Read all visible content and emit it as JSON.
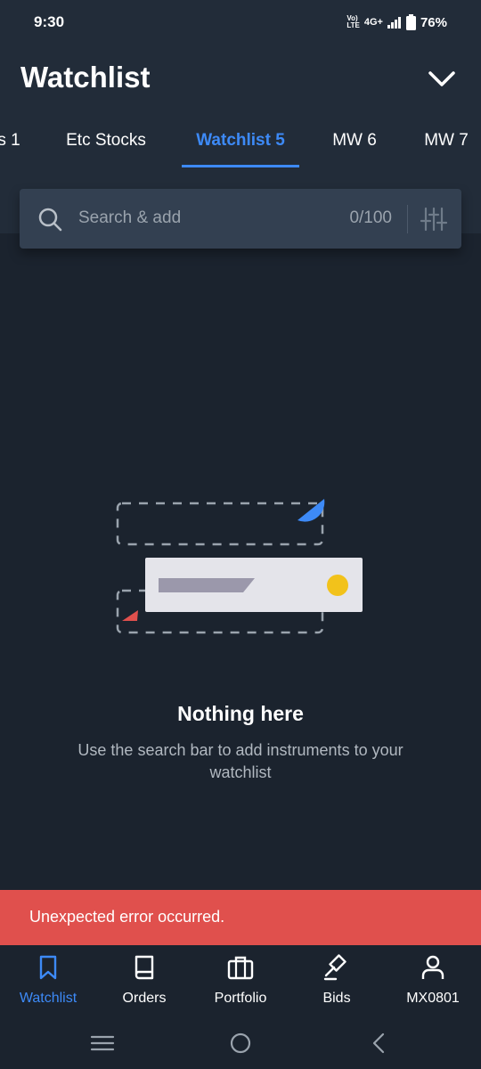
{
  "status_bar": {
    "time": "9:30",
    "volte_top": "Vo)",
    "volte_bottom": "LTE",
    "network": "4G+",
    "battery": "76%"
  },
  "header": {
    "title": "Watchlist",
    "chevron_icon": "chevron-down-icon"
  },
  "tabs": [
    {
      "label": "s 1"
    },
    {
      "label": "Etc Stocks"
    },
    {
      "label": "Watchlist 5",
      "active": true
    },
    {
      "label": "MW 6"
    },
    {
      "label": "MW 7"
    }
  ],
  "search": {
    "placeholder": "Search & add",
    "count": "0/100",
    "search_icon": "search-icon",
    "filter_icon": "filter-sliders-icon"
  },
  "empty_state": {
    "title": "Nothing here",
    "description": "Use the search bar to add instruments to your watchlist"
  },
  "error": {
    "message": "Unexpected error occurred."
  },
  "bottom_nav": [
    {
      "label": "Watchlist",
      "icon": "bookmark-icon",
      "active": true
    },
    {
      "label": "Orders",
      "icon": "book-icon"
    },
    {
      "label": "Portfolio",
      "icon": "briefcase-icon"
    },
    {
      "label": "Bids",
      "icon": "gavel-icon"
    },
    {
      "label": "MX0801",
      "icon": "user-icon"
    }
  ],
  "colors": {
    "background": "#1b232e",
    "header_background": "#222c39",
    "accent": "#3d8af7",
    "error": "#e0504d",
    "illustration_yellow": "#f2c21b",
    "illustration_red": "#e0504d"
  }
}
